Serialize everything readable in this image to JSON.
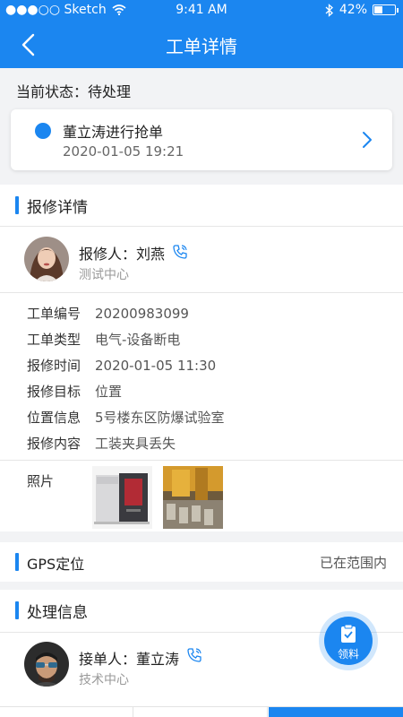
{
  "status_bar": {
    "carrier": "●●●○○ Sketch",
    "time": "9:41 AM",
    "battery": "42%",
    "battery_level": 0.42
  },
  "nav": {
    "title": "工单详情"
  },
  "current_status": {
    "label": "当前状态：",
    "value": "待处理"
  },
  "progress_card": {
    "title": "董立涛进行抢单",
    "datetime": "2020-01-05   19:21"
  },
  "repair_section": {
    "title": "报修详情",
    "reporter": {
      "label": "报修人：",
      "name": "刘燕",
      "dept": "测试中心"
    },
    "fields": [
      {
        "key": "工单编号",
        "value": "20200983099"
      },
      {
        "key": "工单类型",
        "value": "电气-设备断电"
      },
      {
        "key": "报修时间",
        "value": "2020-01-05   11:30"
      },
      {
        "key": "报修目标",
        "value": "位置"
      },
      {
        "key": "位置信息",
        "value": "5号楼东区防爆试验室"
      },
      {
        "key": "报修内容",
        "value": "工装夹具丢失"
      }
    ],
    "photos_label": "照片"
  },
  "gps_section": {
    "title": "GPS定位",
    "status": "已在范围内"
  },
  "process_section": {
    "title": "处理信息",
    "handler": {
      "label": "接单人：",
      "name": "董立涛",
      "dept": "技术中心"
    }
  },
  "fab": {
    "label": "领料"
  },
  "colors": {
    "primary": "#1b86f0",
    "background": "#f2f3f5"
  }
}
